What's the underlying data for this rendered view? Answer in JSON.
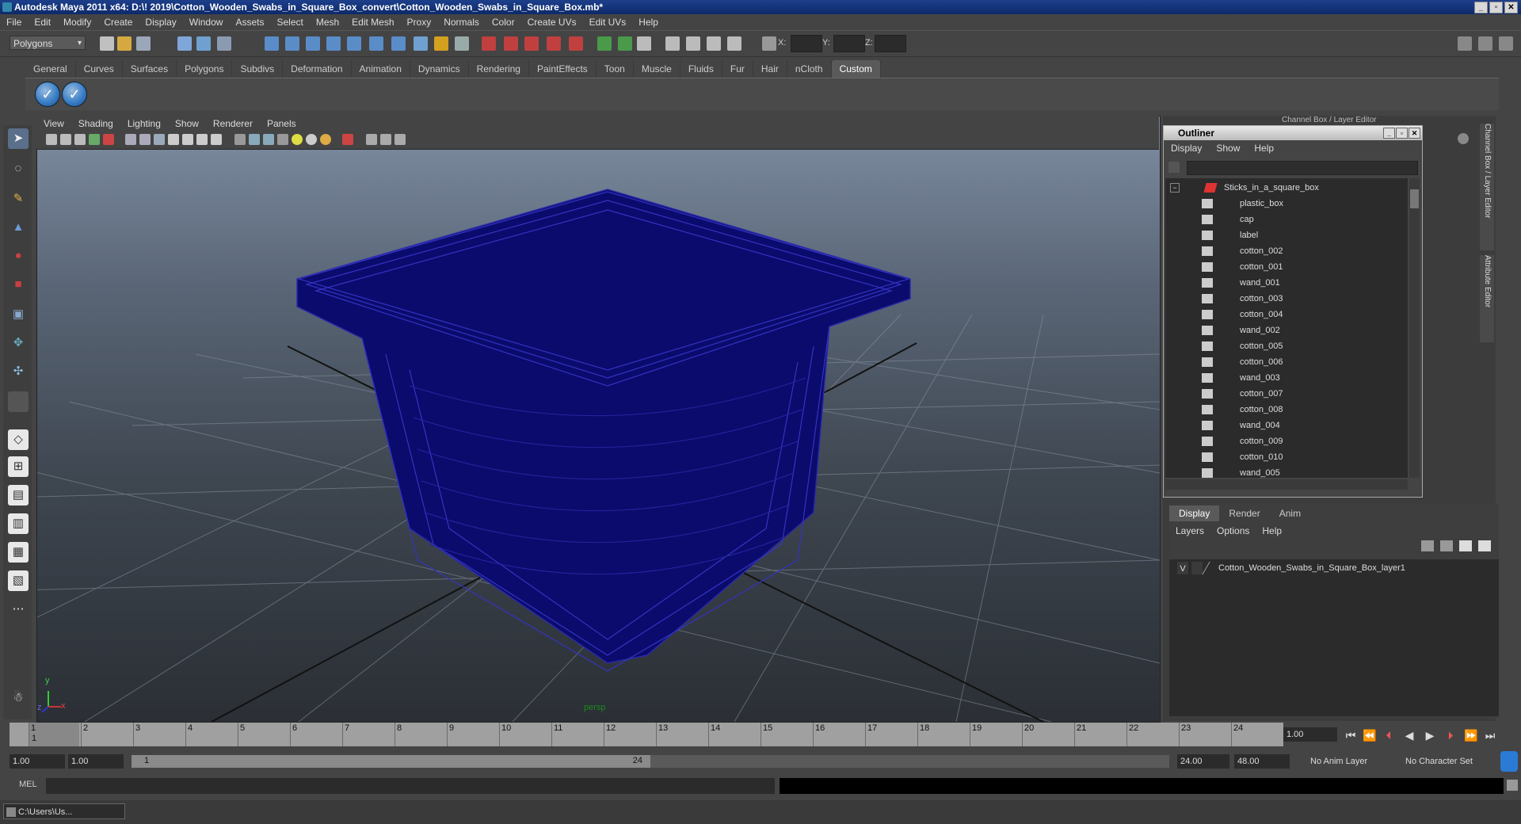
{
  "window": {
    "title": "Autodesk Maya 2011 x64: D:\\! 2019\\Cotton_Wooden_Swabs_in_Square_Box_convert\\Cotton_Wooden_Swabs_in_Square_Box.mb*",
    "btn_min": "_",
    "btn_max": "▫",
    "btn_close": "✕"
  },
  "menubar": [
    "File",
    "Edit",
    "Modify",
    "Create",
    "Display",
    "Window",
    "Assets",
    "Select",
    "Mesh",
    "Edit Mesh",
    "Proxy",
    "Normals",
    "Color",
    "Create UVs",
    "Edit UVs",
    "Help"
  ],
  "status": {
    "mode": "Polygons",
    "x_label": "X:",
    "y_label": "Y:",
    "z_label": "Z:"
  },
  "shelf": {
    "tabs": [
      "General",
      "Curves",
      "Surfaces",
      "Polygons",
      "Subdivs",
      "Deformation",
      "Animation",
      "Dynamics",
      "Rendering",
      "PaintEffects",
      "Toon",
      "Muscle",
      "Fluids",
      "Fur",
      "Hair",
      "nCloth",
      "Custom"
    ],
    "active_tab": "Custom",
    "check_glyph": "✓"
  },
  "viewport": {
    "menu": [
      "View",
      "Shading",
      "Lighting",
      "Show",
      "Renderer",
      "Panels"
    ],
    "camera_label": "persp",
    "axis_y": "y",
    "axis_x": "x",
    "axis_z": "z"
  },
  "dock": {
    "top_label": "Channel Box / Layer Editor",
    "side_tab_1": "Channel Box / Layer Editor",
    "side_tab_2": "Attribute Editor"
  },
  "outliner": {
    "title": "Outliner",
    "menu": [
      "Display",
      "Show",
      "Help"
    ],
    "collapse_glyph": "−",
    "root": "Sticks_in_a_square_box",
    "items": [
      "plastic_box",
      "cap",
      "label",
      "cotton_002",
      "cotton_001",
      "wand_001",
      "cotton_003",
      "cotton_004",
      "wand_002",
      "cotton_005",
      "cotton_006",
      "wand_003",
      "cotton_007",
      "cotton_008",
      "wand_004",
      "cotton_009",
      "cotton_010",
      "wand_005"
    ]
  },
  "layer_editor": {
    "tabs": [
      "Display",
      "Render",
      "Anim"
    ],
    "active_tab": "Display",
    "menu": [
      "Layers",
      "Options",
      "Help"
    ],
    "layer_visibility": "V",
    "layer_name": "Cotton_Wooden_Swabs_in_Square_Box_layer1"
  },
  "timeline": {
    "frames": [
      "1",
      "2",
      "3",
      "4",
      "5",
      "6",
      "7",
      "8",
      "9",
      "10",
      "11",
      "12",
      "13",
      "14",
      "15",
      "16",
      "17",
      "18",
      "19",
      "20",
      "21",
      "22",
      "23",
      "24"
    ],
    "current_frame_marker": "1",
    "current_time": "1.00",
    "playback": [
      "⏮",
      "⏪",
      "⏴",
      "◀",
      "▶",
      "⏵",
      "⏩",
      "⏭"
    ]
  },
  "range": {
    "start": "1.00",
    "playback_start": "1.00",
    "slider_start": "1",
    "slider_end": "24",
    "playback_end": "24.00",
    "end": "48.00",
    "anim_layer": "No Anim Layer",
    "character_set": "No Character Set"
  },
  "cmdline": {
    "label": "MEL"
  },
  "taskbar": {
    "item": "C:\\Users\\Us..."
  },
  "colors": {
    "wireframe": "#0b0b6e",
    "viewport_top": "#7f8ea3",
    "viewport_bottom": "#2b2f35",
    "title_bar": "#1d3f8a"
  }
}
